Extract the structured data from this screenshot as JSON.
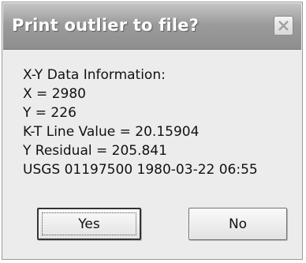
{
  "dialog": {
    "title": "Print outlier to file?",
    "close_icon": "close-icon"
  },
  "info": {
    "lines": [
      "X-Y Data Information:",
      "X = 2980",
      "Y = 226",
      "K-T Line Value = 20.15904",
      "Y Residual  = 205.841",
      "USGS 01197500 1980-03-22 06:55"
    ]
  },
  "buttons": {
    "yes_label": "Yes",
    "no_label": "No"
  }
}
